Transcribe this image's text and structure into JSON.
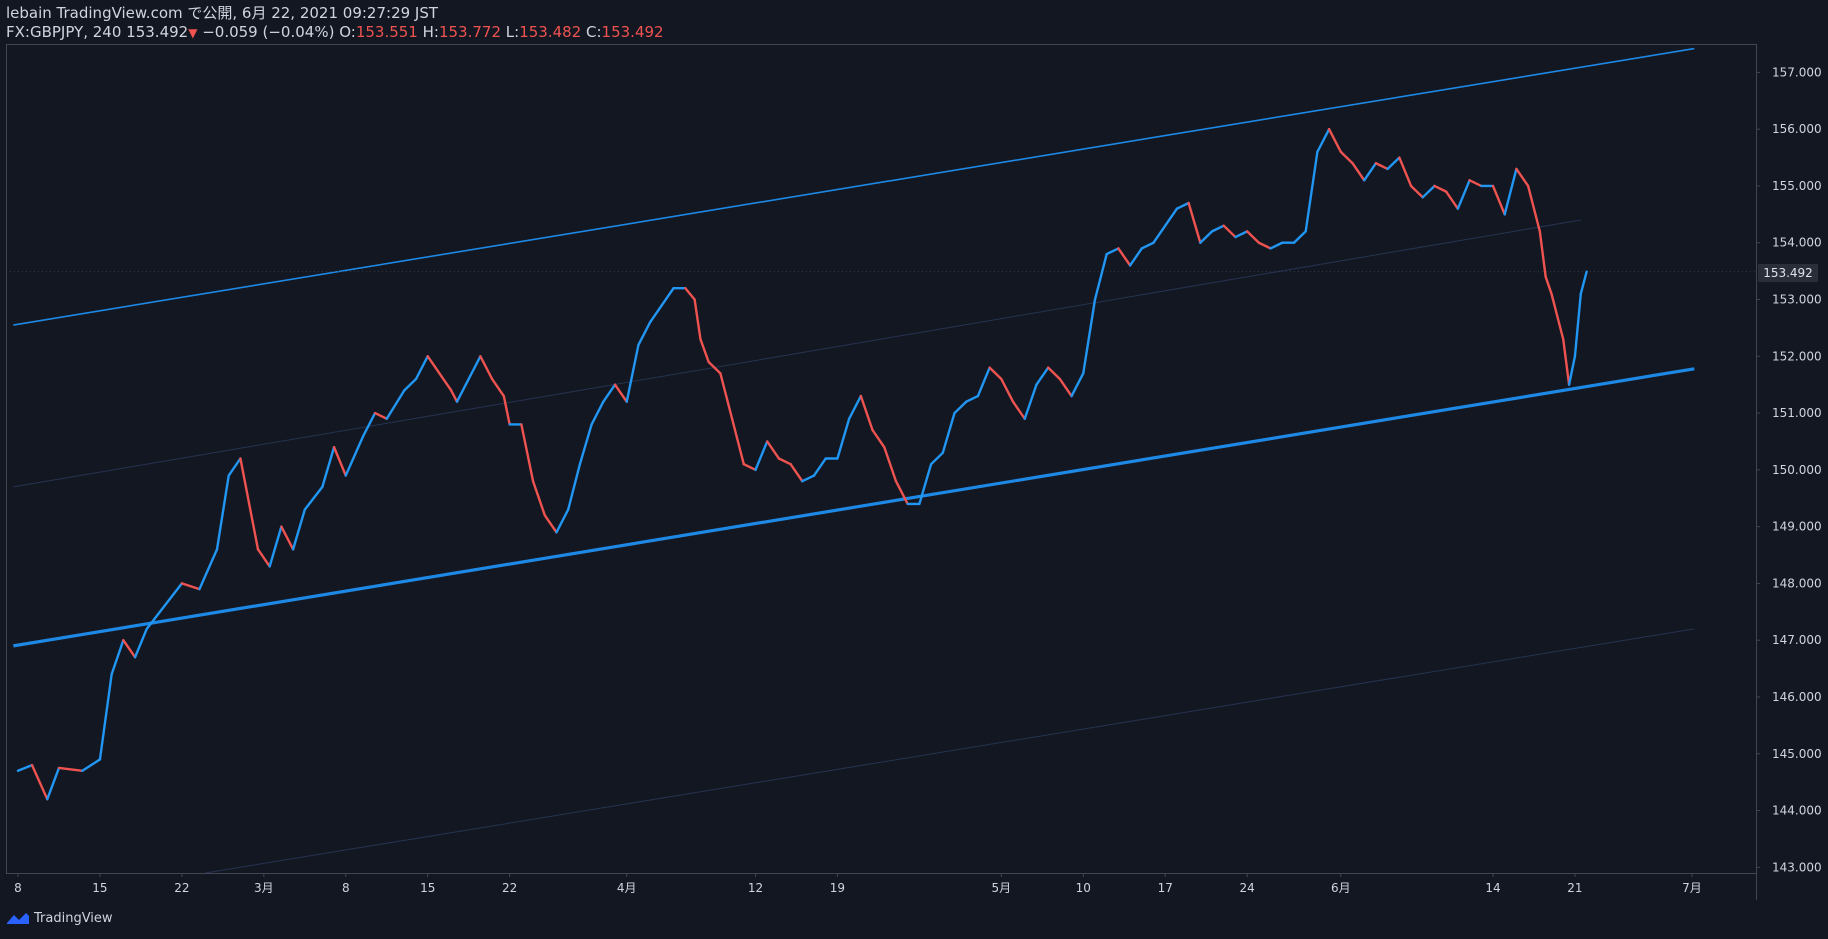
{
  "header": {
    "line1": "lebain TradingView.com で公開, 6月 22, 2021 09:27:29 JST",
    "symbol": "FX:GBPJPY, 240",
    "last": "153.492",
    "change": "−0.059 (−0.04%)",
    "o_label": "O:",
    "o_value": "153.551",
    "h_label": "H:",
    "h_value": "153.772",
    "l_label": "L:",
    "l_value": "153.482",
    "c_label": "C:",
    "c_value": "153.492"
  },
  "footer": {
    "brand": "TradingView"
  },
  "colors": {
    "bg": "#131722",
    "up": "#2196f3",
    "down": "#ef5350",
    "channel": "#1e88e5",
    "text": "#d1d4dc"
  },
  "chart_data": {
    "type": "line",
    "symbol": "FX:GBPJPY",
    "interval": "240",
    "current_price": 153.492,
    "ylim": [
      142.9,
      157.5
    ],
    "yticks": [
      143,
      144,
      145,
      146,
      147,
      148,
      149,
      150,
      151,
      152,
      153,
      154,
      155,
      156,
      157
    ],
    "xlabels": [
      {
        "label": "8",
        "day": 0
      },
      {
        "label": "15",
        "day": 7
      },
      {
        "label": "22",
        "day": 14
      },
      {
        "label": "3月",
        "day": 21
      },
      {
        "label": "8",
        "day": 28
      },
      {
        "label": "15",
        "day": 35
      },
      {
        "label": "22",
        "day": 42
      },
      {
        "label": "4月",
        "day": 52
      },
      {
        "label": "12",
        "day": 63
      },
      {
        "label": "19",
        "day": 70
      },
      {
        "label": "5月",
        "day": 84
      },
      {
        "label": "10",
        "day": 91
      },
      {
        "label": "17",
        "day": 98
      },
      {
        "label": "24",
        "day": 105
      },
      {
        "label": "6月",
        "day": 113
      },
      {
        "label": "14",
        "day": 126
      },
      {
        "label": "21",
        "day": 133
      },
      {
        "label": "7月",
        "day": 143
      }
    ],
    "price_path": [
      [
        0,
        144.7
      ],
      [
        1.2,
        144.8
      ],
      [
        2.5,
        144.2
      ],
      [
        3.5,
        144.75
      ],
      [
        5.5,
        144.7
      ],
      [
        7,
        144.9
      ],
      [
        8,
        146.4
      ],
      [
        9,
        147.0
      ],
      [
        10,
        146.7
      ],
      [
        11,
        147.2
      ],
      [
        12.5,
        147.6
      ],
      [
        14,
        148.0
      ],
      [
        15.5,
        147.9
      ],
      [
        17,
        148.6
      ],
      [
        18,
        149.9
      ],
      [
        19,
        150.2
      ],
      [
        20.5,
        148.6
      ],
      [
        21.5,
        148.3
      ],
      [
        22.5,
        149.0
      ],
      [
        23.5,
        148.6
      ],
      [
        24.5,
        149.3
      ],
      [
        26,
        149.7
      ],
      [
        27,
        150.4
      ],
      [
        28,
        149.9
      ],
      [
        29.5,
        150.6
      ],
      [
        30.5,
        151.0
      ],
      [
        31.5,
        150.9
      ],
      [
        33,
        151.4
      ],
      [
        34,
        151.6
      ],
      [
        35,
        152.0
      ],
      [
        36,
        151.7
      ],
      [
        37,
        151.4
      ],
      [
        37.5,
        151.2
      ],
      [
        38.5,
        151.6
      ],
      [
        39.5,
        152.0
      ],
      [
        40.5,
        151.6
      ],
      [
        41.5,
        151.3
      ],
      [
        42,
        150.8
      ],
      [
        43,
        150.8
      ],
      [
        44,
        149.8
      ],
      [
        45,
        149.2
      ],
      [
        46,
        148.9
      ],
      [
        47,
        149.3
      ],
      [
        48,
        150.1
      ],
      [
        49,
        150.8
      ],
      [
        50,
        151.2
      ],
      [
        51,
        151.5
      ],
      [
        52,
        151.2
      ],
      [
        53,
        152.2
      ],
      [
        54,
        152.6
      ],
      [
        55,
        152.9
      ],
      [
        56,
        153.2
      ],
      [
        57,
        153.2
      ],
      [
        57.8,
        153.0
      ],
      [
        58.3,
        152.3
      ],
      [
        59,
        151.9
      ],
      [
        60,
        151.7
      ],
      [
        61,
        150.9
      ],
      [
        62,
        150.1
      ],
      [
        63,
        150.0
      ],
      [
        64,
        150.5
      ],
      [
        65,
        150.2
      ],
      [
        66,
        150.1
      ],
      [
        67,
        149.8
      ],
      [
        68,
        149.9
      ],
      [
        69,
        150.2
      ],
      [
        70,
        150.2
      ],
      [
        71,
        150.9
      ],
      [
        72,
        151.3
      ],
      [
        73,
        150.7
      ],
      [
        74,
        150.4
      ],
      [
        75,
        149.8
      ],
      [
        76,
        149.4
      ],
      [
        77,
        149.4
      ],
      [
        78,
        150.1
      ],
      [
        79,
        150.3
      ],
      [
        80,
        151.0
      ],
      [
        81,
        151.2
      ],
      [
        82,
        151.3
      ],
      [
        83,
        151.8
      ],
      [
        84,
        151.6
      ],
      [
        85,
        151.2
      ],
      [
        86,
        150.9
      ],
      [
        87,
        151.5
      ],
      [
        88,
        151.8
      ],
      [
        89,
        151.6
      ],
      [
        90,
        151.3
      ],
      [
        91,
        151.7
      ],
      [
        92,
        153.0
      ],
      [
        93,
        153.8
      ],
      [
        94,
        153.9
      ],
      [
        95,
        153.6
      ],
      [
        96,
        153.9
      ],
      [
        97,
        154.0
      ],
      [
        98,
        154.3
      ],
      [
        99,
        154.6
      ],
      [
        100,
        154.7
      ],
      [
        101,
        154.0
      ],
      [
        102,
        154.2
      ],
      [
        103,
        154.3
      ],
      [
        104,
        154.1
      ],
      [
        105,
        154.2
      ],
      [
        106,
        154.0
      ],
      [
        107,
        153.9
      ],
      [
        108,
        154.0
      ],
      [
        109,
        154.0
      ],
      [
        110,
        154.2
      ],
      [
        111,
        155.6
      ],
      [
        112,
        156.0
      ],
      [
        113,
        155.6
      ],
      [
        114,
        155.4
      ],
      [
        115,
        155.1
      ],
      [
        116,
        155.4
      ],
      [
        117,
        155.3
      ],
      [
        118,
        155.5
      ],
      [
        119,
        155.0
      ],
      [
        120,
        154.8
      ],
      [
        121,
        155.0
      ],
      [
        122,
        154.9
      ],
      [
        123,
        154.6
      ],
      [
        124,
        155.1
      ],
      [
        125,
        155.0
      ],
      [
        126,
        155.0
      ],
      [
        127,
        154.5
      ],
      [
        128,
        155.3
      ],
      [
        129,
        155.0
      ],
      [
        130,
        154.2
      ],
      [
        130.5,
        153.4
      ],
      [
        131,
        153.1
      ],
      [
        132,
        152.3
      ],
      [
        132.5,
        151.5
      ],
      [
        133,
        152.0
      ],
      [
        133.5,
        153.1
      ],
      [
        134,
        153.49
      ]
    ],
    "channel": {
      "upper": [
        [
          -0.4,
          152.55
        ],
        [
          143.2,
          157.42
        ]
      ],
      "lower": [
        [
          -0.4,
          146.9
        ],
        [
          143.2,
          151.78
        ]
      ],
      "mid_upper": [
        [
          -0.4,
          149.7
        ],
        [
          133.5,
          154.4
        ]
      ],
      "mid_lower": [
        [
          16,
          142.9
        ],
        [
          143.2,
          147.2
        ]
      ]
    },
    "price_line": 153.492,
    "grid": false
  }
}
